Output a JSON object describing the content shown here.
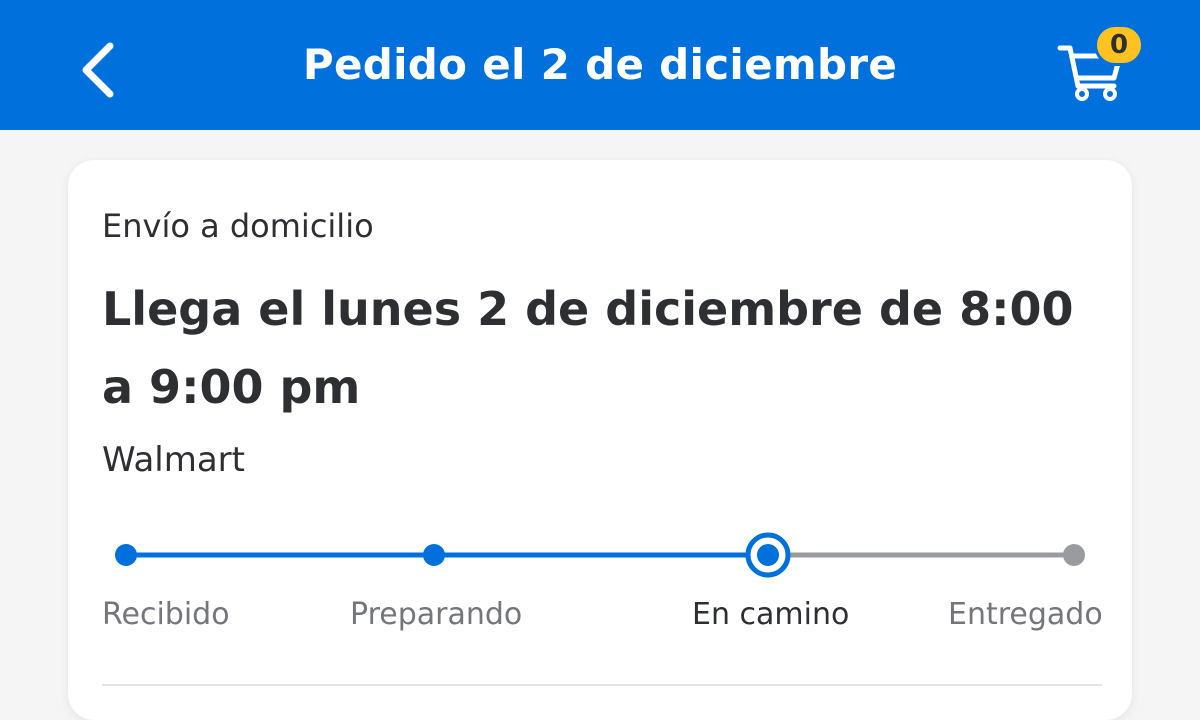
{
  "header": {
    "title": "Pedido el 2 de diciembre",
    "back_icon": "chevron-left-icon",
    "cart_icon": "cart-icon",
    "cart_count": "0",
    "background_color": "#0071dc",
    "badge_color": "#ffc220"
  },
  "order": {
    "shipping_type": "Envío a domicilio",
    "arrival_text": "Llega el lunes 2 de diciembre de 8:00 a 9:00 pm",
    "store": "Walmart"
  },
  "tracker": {
    "current_step_index": 2,
    "active_color": "#0071dc",
    "inactive_color": "#9a9ba0",
    "steps": [
      {
        "label": "Recibido",
        "status": "complete"
      },
      {
        "label": "Preparando",
        "status": "complete"
      },
      {
        "label": "En camino",
        "status": "current"
      },
      {
        "label": "Entregado",
        "status": "pending"
      }
    ]
  }
}
